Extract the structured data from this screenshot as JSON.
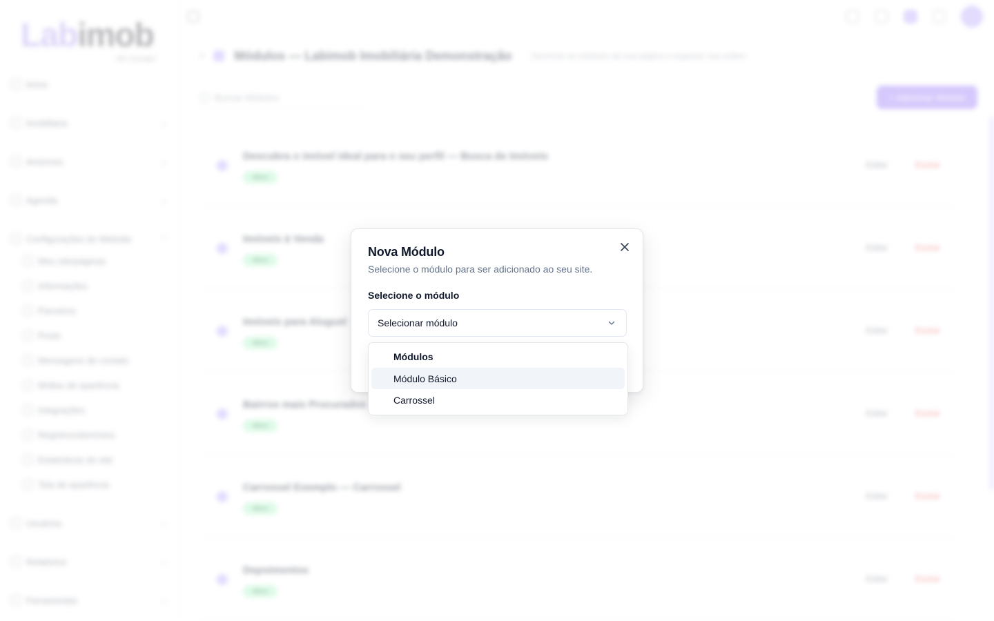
{
  "sidebar": {
    "logo": {
      "text_main": "Lab",
      "text_accent": "imob",
      "subtitle": "site manager"
    },
    "items": [
      {
        "label": "Início",
        "icon": "home-icon",
        "chevron": false
      },
      {
        "label": "Imobiliária",
        "icon": "building-icon",
        "chevron": true
      },
      {
        "label": "Anúncios",
        "icon": "megaphone-icon",
        "chevron": true
      },
      {
        "label": "Agenda",
        "icon": "calendar-icon",
        "chevron": true
      },
      {
        "label": "Configurações do Website",
        "icon": "globe-icon",
        "chevron": true
      }
    ],
    "sub_items": [
      {
        "label": "Meu site/páginas",
        "icon": "monitor-icon"
      },
      {
        "label": "Informações",
        "icon": "info-icon"
      },
      {
        "label": "Parceiros",
        "icon": "handshake-icon"
      },
      {
        "label": "Posts",
        "icon": "pin-icon"
      },
      {
        "label": "Mensagens de contato",
        "icon": "mail-icon"
      },
      {
        "label": "Mídias de aparência",
        "icon": "image-icon"
      },
      {
        "label": "Integrações",
        "icon": "plug-icon"
      },
      {
        "label": "Registros/domínios",
        "icon": "link-icon"
      },
      {
        "label": "Estatísticas do site",
        "icon": "chart-icon"
      },
      {
        "label": "Tela de aparência",
        "icon": "palette-icon"
      }
    ],
    "bottom_items": [
      {
        "label": "Usuários",
        "icon": "users-icon",
        "chevron": true
      },
      {
        "label": "Relatórios",
        "icon": "report-icon",
        "chevron": true
      },
      {
        "label": "Ferramentas",
        "icon": "tools-icon",
        "chevron": true
      }
    ]
  },
  "header": {
    "title": "Módulos — Labimob Imobiliária Demonstração",
    "subtitle": "Gerencie os módulos da sua página e organize sua ordem",
    "search_placeholder": "Buscar Módulos",
    "add_label": "+ Adicionar Módulo"
  },
  "rows": [
    {
      "title": "Descubra o imóvel ideal para o seu perfil — Busca de Imóveis",
      "badge": "Ativo",
      "edit": "Editar",
      "delete": "Excluir"
    },
    {
      "title": "Imóveis à Venda",
      "badge": "Ativo",
      "edit": "Editar",
      "delete": "Excluir"
    },
    {
      "title": "Imóveis para Aluguel",
      "badge": "Ativo",
      "edit": "Editar",
      "delete": "Excluir"
    },
    {
      "title": "Bairros mais Procurados",
      "badge": "Ativo",
      "edit": "Editar",
      "delete": "Excluir"
    },
    {
      "title": "Carrossel Exemplo — Carrossel",
      "badge": "Ativo",
      "edit": "Editar",
      "delete": "Excluir"
    },
    {
      "title": "Depoimentos",
      "badge": "Ativo",
      "edit": "Editar",
      "delete": "Excluir"
    }
  ],
  "modal": {
    "title": "Nova Módulo",
    "description": "Selecione o módulo para ser adicionado ao seu site.",
    "field_label": "Selecione o módulo",
    "select_value": "Selecionar módulo",
    "dropdown": {
      "group_label": "Módulos",
      "options": [
        {
          "label": "Módulo Básico",
          "active": true
        },
        {
          "label": "Carrossel",
          "active": false
        }
      ]
    }
  },
  "colors": {
    "accent": "#8b5cf6",
    "accent_light": "#c4b5fd",
    "hover_bg": "#f1f5f9",
    "border": "#e2e8f0",
    "text_primary": "#0f172a",
    "text_muted": "#64748b"
  }
}
